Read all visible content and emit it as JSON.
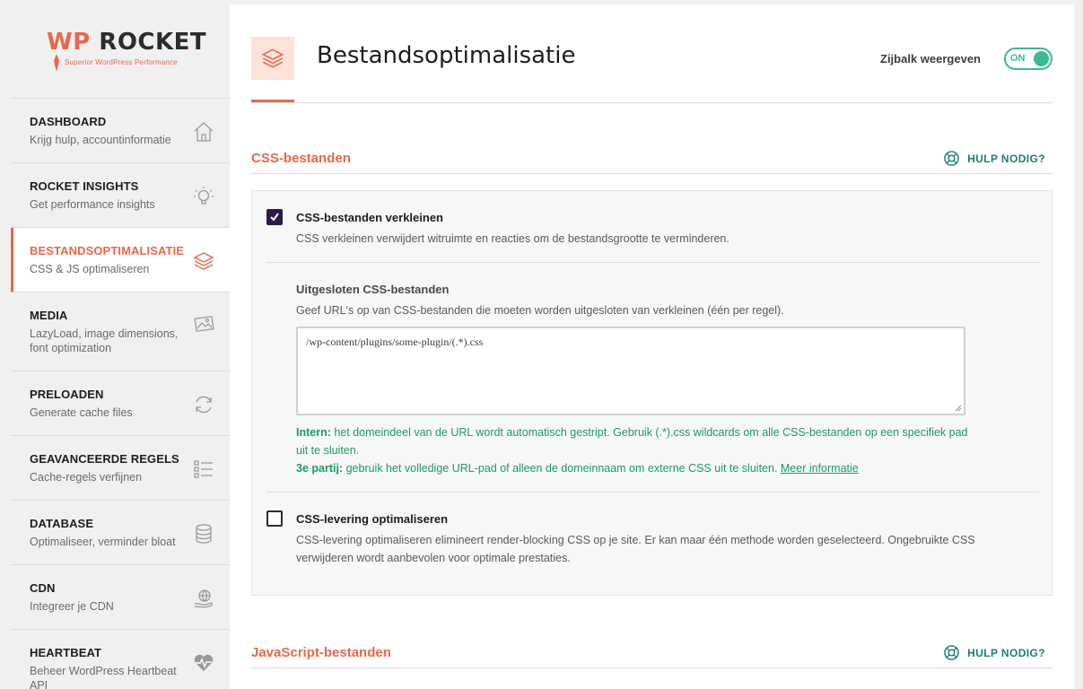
{
  "logo": {
    "wp": "WP",
    "rocket": "ROCKET",
    "tagline": "Superior WordPress Performance"
  },
  "nav": [
    {
      "title": "DASHBOARD",
      "sub": "Krijg hulp, accountinformatie",
      "icon": "home-icon"
    },
    {
      "title": "ROCKET INSIGHTS",
      "sub": "Get performance insights",
      "icon": "lightbulb-icon"
    },
    {
      "title": "BESTANDSOPTIMALISATIE",
      "sub": "CSS & JS optimaliseren",
      "icon": "layers-icon"
    },
    {
      "title": "MEDIA",
      "sub": "LazyLoad, image dimensions, font optimization",
      "icon": "image-icon"
    },
    {
      "title": "PRELOADEN",
      "sub": "Generate cache files",
      "icon": "refresh-icon"
    },
    {
      "title": "GEAVANCEERDE REGELS",
      "sub": "Cache-regels verfijnen",
      "icon": "list-icon"
    },
    {
      "title": "DATABASE",
      "sub": "Optimaliseer, verminder bloat",
      "icon": "database-icon"
    },
    {
      "title": "CDN",
      "sub": "Integreer je CDN",
      "icon": "globe-hand-icon"
    },
    {
      "title": "HEARTBEAT",
      "sub": "Beheer WordPress Heartbeat API",
      "icon": "heartbeat-icon"
    }
  ],
  "header": {
    "title": "Bestandsoptimalisatie",
    "sidebar_toggle_label": "Zijbalk weergeven",
    "toggle_state": "ON"
  },
  "css_section": {
    "title": "CSS-bestanden",
    "help": "HULP NODIG?",
    "minify": {
      "title": "CSS-bestanden verkleinen",
      "desc": "CSS verkleinen verwijdert witruimte en reacties om de bestandsgrootte te verminderen.",
      "checked": true
    },
    "exclude": {
      "title": "Uitgesloten CSS-bestanden",
      "desc": "Geef URL's op van CSS-bestanden die moeten worden uitgesloten van verkleinen (één per regel).",
      "value": "/wp-content/plugins/some-plugin/(.*).css",
      "note1_label": "Intern:",
      "note1_text": " het domeindeel van de URL wordt automatisch gestript. Gebruik (.*).css wildcards om alle CSS-bestanden op een specifiek pad uit te sluiten.",
      "note2_label": "3e partij:",
      "note2_text": " gebruik het volledige URL-pad of alleen de domeinnaam om externe CSS uit te sluiten. ",
      "note2_link": "Meer informatie"
    },
    "delivery": {
      "title": "CSS-levering optimaliseren",
      "desc": "CSS-levering optimaliseren elimineert render-blocking CSS op je site. Er kan maar één methode worden geselecteerd. Ongebruikte CSS verwijderen wordt aanbevolen voor optimale prestaties.",
      "checked": false
    }
  },
  "js_section": {
    "title": "JavaScript-bestanden",
    "help": "HULP NODIG?"
  },
  "colors": {
    "accent": "#e8684a",
    "green": "#3cba8f",
    "teal": "#1e7e74",
    "checkbox": "#2c1a4a"
  }
}
